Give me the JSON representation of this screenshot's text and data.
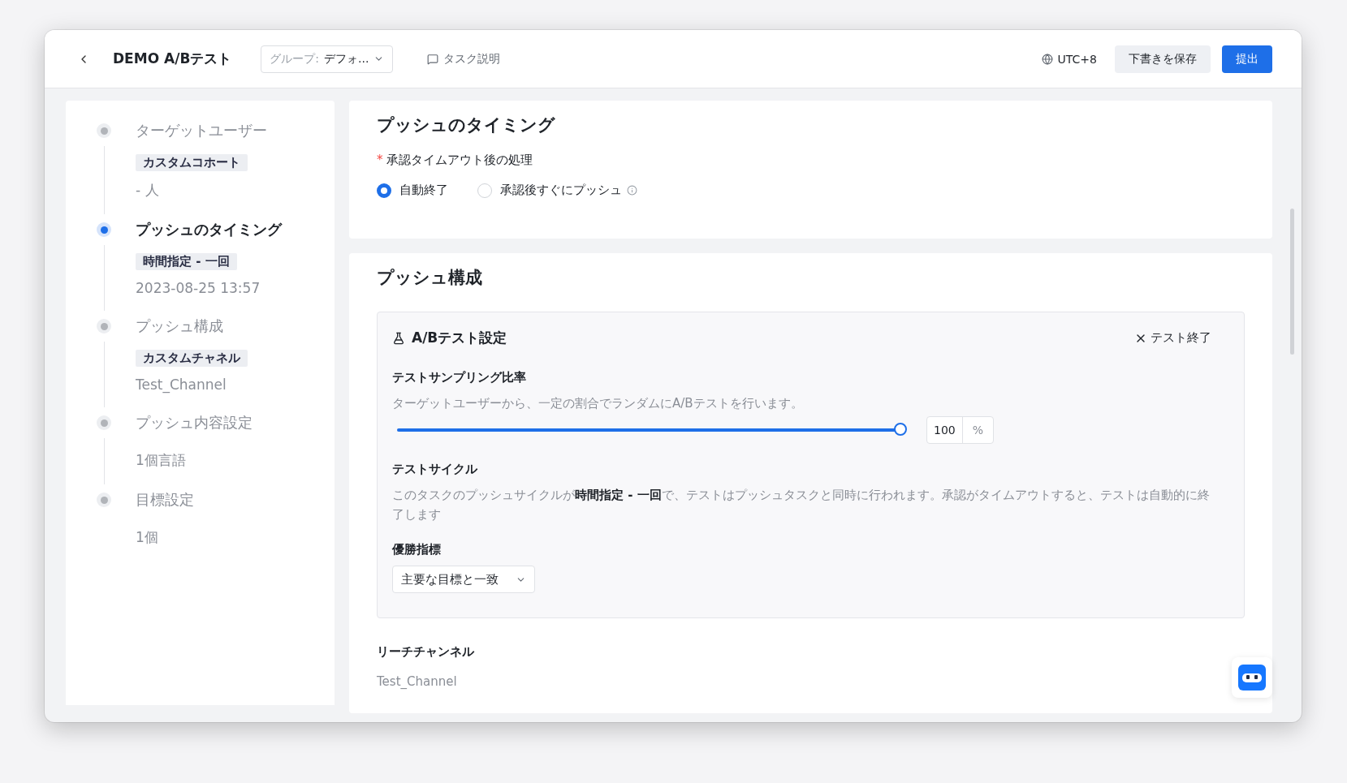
{
  "header": {
    "title": "DEMO A/Bテスト",
    "group": {
      "label": "グループ:",
      "value": "デフォ..."
    },
    "task_description": "タスク説明",
    "timezone": "UTC+8",
    "save_draft": "下書きを保存",
    "submit": "提出"
  },
  "steps": [
    {
      "title": "ターゲットユーザー",
      "selected": false,
      "tag": "カスタムコホート",
      "detail": "- 人"
    },
    {
      "title": "プッシュのタイミング",
      "selected": true,
      "tag": "時間指定 - 一回",
      "detail": "2023-08-25 13:57"
    },
    {
      "title": "プッシュ構成",
      "selected": false,
      "tag": "カスタムチャネル",
      "detail": "Test_Channel"
    },
    {
      "title": "プッシュ内容設定",
      "selected": false,
      "detail": "1個言語"
    },
    {
      "title": "目標設定",
      "selected": false,
      "detail": "1個"
    }
  ],
  "timing_card": {
    "title": "プッシュのタイミング",
    "field_label": "承認タイムアウト後の処理",
    "required_mark": "*",
    "options": [
      {
        "label": "自動終了",
        "selected": true,
        "info": false
      },
      {
        "label": "承認後すぐにプッシュ",
        "selected": false,
        "info": true
      }
    ]
  },
  "config_card": {
    "title": "プッシュ構成",
    "ab_test": {
      "title": "A/Bテスト設定",
      "end_test": "テスト終了",
      "sampling": {
        "label": "テストサンプリング比率",
        "hint": "ターゲットユーザーから、一定の割合でランダムにA/Bテストを行います。",
        "level": 1,
        "value": "100",
        "unit": "%"
      },
      "cycle": {
        "label": "テストサイクル",
        "text": "このタスクのプッシュサイクルが**時間指定 - 一回**で、テストはプッシュタスクと同時に行われます。承認がタイムアウトすると、テストは自動的に終了します"
      },
      "metric": {
        "label": "優勝指標",
        "value": "主要な目標と一致"
      }
    },
    "reach_channel": {
      "label": "リーチチャンネル",
      "value": "Test_Channel"
    }
  }
}
